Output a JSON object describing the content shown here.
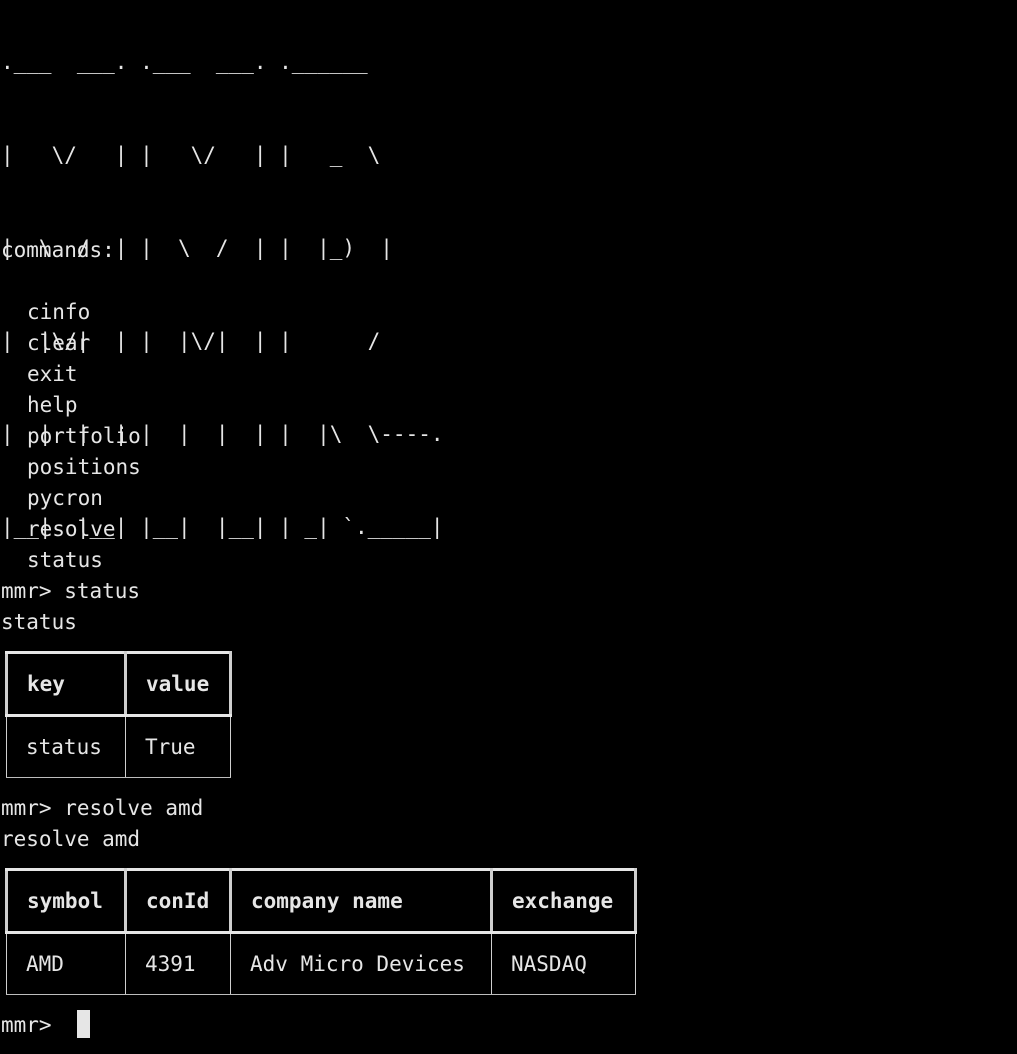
{
  "banner": {
    "rows": [
      ".___  ___. .___  ___. .______",
      "|   \\/   | |   \\/   | |   _  \\",
      "|  \\  /  | |  \\  /  | |  |_)  |",
      "|  |\\/|  | |  |\\/|  | |      /",
      "|  |  |  | |  |  |  | |  |\\  \\----.",
      "|__|  |__| |__|  |__| | _| `._____|"
    ]
  },
  "help": {
    "heading": "commands:",
    "commands": [
      "cinfo",
      "clear",
      "exit",
      "help",
      "portfolio",
      "positions",
      "pycron",
      "resolve",
      "status"
    ]
  },
  "session": {
    "prompt1": "mmr> status",
    "echo1": "status",
    "status_table": {
      "headers": [
        "key",
        "value"
      ],
      "rows": [
        [
          "status",
          "True"
        ]
      ]
    },
    "prompt2": "mmr> resolve amd",
    "echo2": "resolve amd",
    "resolve_table": {
      "headers": [
        "symbol",
        "conId",
        "company name",
        "exchange"
      ],
      "rows": [
        [
          "AMD",
          "4391",
          "Adv Micro Devices",
          "NASDAQ"
        ]
      ]
    },
    "prompt3": "mmr> "
  }
}
